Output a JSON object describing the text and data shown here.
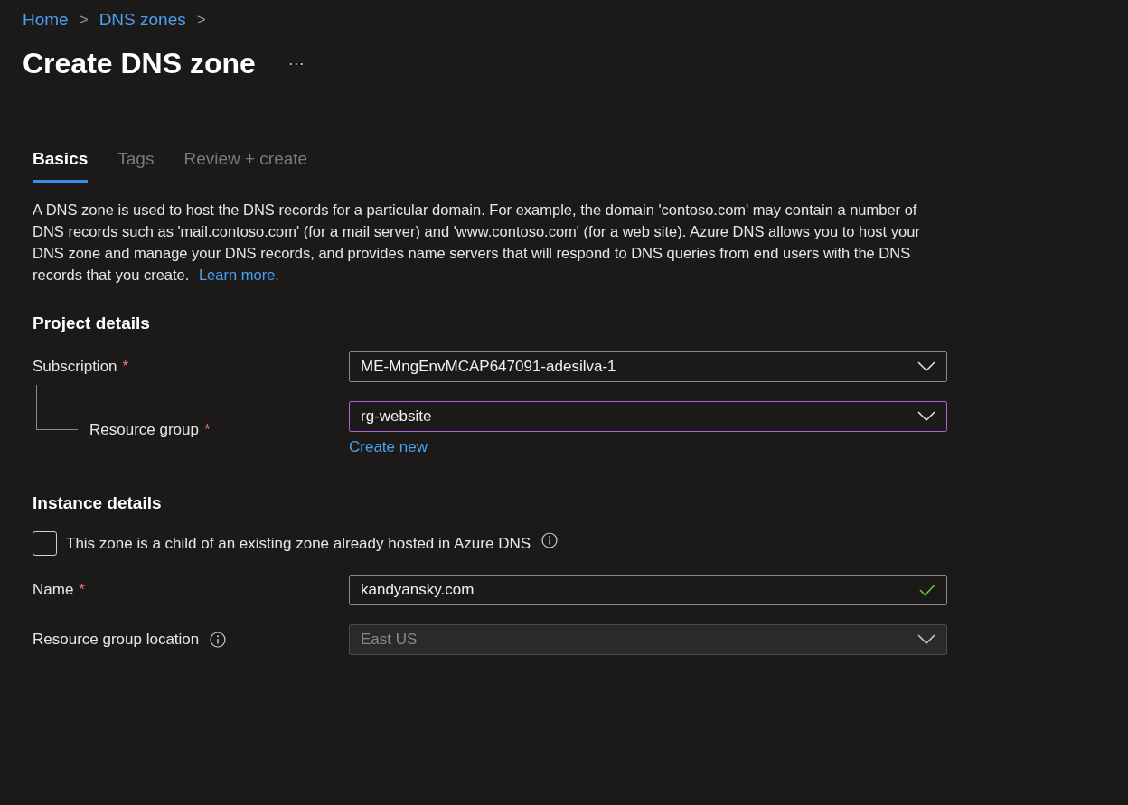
{
  "breadcrumb": [
    {
      "label": "Home",
      "separator": ">"
    },
    {
      "label": "DNS zones",
      "separator": ">"
    }
  ],
  "page_title": "Create DNS zone",
  "more_button": "···",
  "tabs": [
    {
      "label": "Basics",
      "selected": true
    },
    {
      "label": "Tags",
      "selected": false
    },
    {
      "label": "Review + create",
      "selected": false
    }
  ],
  "description": "A DNS zone is used to host the DNS records for a particular domain. For example, the domain 'contoso.com' may contain a number of DNS records such as 'mail.contoso.com' (for a mail server) and 'www.contoso.com' (for a web site). Azure DNS allows you to host your DNS zone and manage your DNS records, and provides name servers that will respond to DNS queries from end users with the DNS records that you create.",
  "learn_more_link": "Learn more.",
  "sections": [
    {
      "heading": "Project details",
      "fields": [
        {
          "kind": "dropdown",
          "label": "Subscription",
          "required_mark": "*",
          "value": "ME-MngEnvMCAP647091-adesilva-1",
          "focused": false,
          "disabled": false,
          "children": [
            {
              "kind": "dropdown",
              "label": "Resource group",
              "required_mark": "*",
              "value": "rg-website",
              "focused": true,
              "disabled": false,
              "link": "Create new"
            }
          ]
        }
      ]
    },
    {
      "heading": "Instance details",
      "fields": [
        {
          "kind": "checkbox",
          "label": "This zone is a child of an existing zone already hosted in Azure DNS",
          "checked": false,
          "info": true
        },
        {
          "kind": "text",
          "label": "Name",
          "required_mark": "*",
          "value": "kandyansky.com",
          "valid": true
        },
        {
          "kind": "dropdown",
          "label": "Resource group location",
          "info": true,
          "value": "East US",
          "focused": false,
          "disabled": true
        }
      ]
    }
  ]
}
